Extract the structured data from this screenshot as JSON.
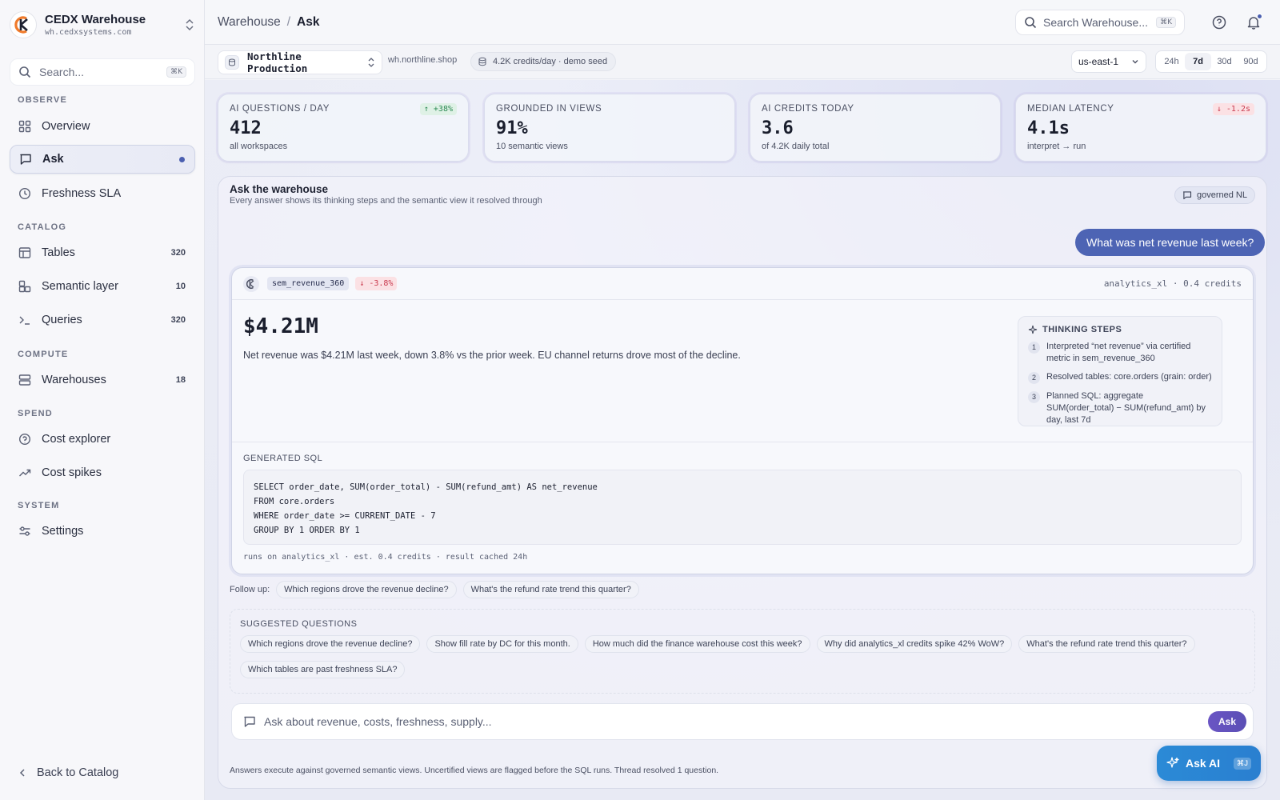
{
  "brand": {
    "name": "CEDX Warehouse",
    "host": "wh.cedxsystems.com"
  },
  "sidebar": {
    "search_placeholder": "Search...",
    "search_shortcut": "⌘K",
    "sections": {
      "observe": "OBSERVE",
      "catalog": "CATALOG",
      "compute": "COMPUTE",
      "spend": "SPEND",
      "system": "SYSTEM"
    },
    "items": {
      "overview": {
        "label": "Overview",
        "icon": "grid-icon"
      },
      "ask": {
        "label": "Ask",
        "icon": "chat-icon",
        "active": true
      },
      "freshness": {
        "label": "Freshness SLA",
        "icon": "clock-icon"
      },
      "tables": {
        "label": "Tables",
        "count": "320",
        "icon": "table-icon"
      },
      "semantic": {
        "label": "Semantic layer",
        "count": "10",
        "icon": "layers-icon"
      },
      "queries": {
        "label": "Queries",
        "count": "320",
        "icon": "terminal-icon"
      },
      "warehouses": {
        "label": "Warehouses",
        "count": "18",
        "icon": "server-icon"
      },
      "cost_explorer": {
        "label": "Cost explorer",
        "icon": "coin-icon"
      },
      "cost_spikes": {
        "label": "Cost spikes",
        "icon": "trend-up-icon"
      },
      "settings": {
        "label": "Settings",
        "icon": "sliders-icon"
      }
    },
    "back_label": "Back to Catalog"
  },
  "header": {
    "breadcrumb_root": "Warehouse",
    "breadcrumb_sep": "/",
    "breadcrumb_current": "Ask",
    "search_placeholder": "Search Warehouse...",
    "search_shortcut": "⌘K"
  },
  "subbar": {
    "environment": "Northline Production",
    "host": "wh.northline.shop",
    "credits": "4.2K credits/day · demo seed",
    "region": "us-east-1",
    "ranges": [
      "24h",
      "7d",
      "30d",
      "90d"
    ],
    "selected_range": "7d"
  },
  "kpis": [
    {
      "label": "AI QUESTIONS / DAY",
      "value": "412",
      "sub": "all workspaces",
      "delta": "↑ +38%",
      "delta_dir": "up"
    },
    {
      "label": "GROUNDED IN VIEWS",
      "value": "91%",
      "sub": "10 semantic views",
      "delta": "",
      "delta_dir": ""
    },
    {
      "label": "AI CREDITS TODAY",
      "value": "3.6",
      "sub": "of 4.2K daily total",
      "delta": "",
      "delta_dir": ""
    },
    {
      "label": "MEDIAN LATENCY",
      "value": "4.1s",
      "sub": "interpret → run",
      "delta": "↓ -1.2s",
      "delta_dir": "down"
    }
  ],
  "ask": {
    "title": "Ask the warehouse",
    "subtitle": "Every answer shows its thinking steps and the semantic view it resolved through",
    "badge": "governed NL",
    "user_question": "What was net revenue last week?",
    "answer": {
      "view": "sem_revenue_360",
      "delta": "↓ -3.8%",
      "meta": "analytics_xl · 0.4 credits",
      "value": "$4.21M",
      "summary": "Net revenue was $4.21M last week, down 3.8% vs the prior week. EU channel returns drove most of the decline.",
      "thinking_title": "THINKING STEPS",
      "steps": [
        {
          "n": "1",
          "text": "Interpreted “net revenue” via certified metric in sem_revenue_360"
        },
        {
          "n": "2",
          "text": "Resolved tables: core.orders (grain: order)"
        },
        {
          "n": "3",
          "text": "Planned SQL: aggregate SUM(order_total) − SUM(refund_amt) by day, last 7d"
        }
      ],
      "sql_label": "GENERATED SQL",
      "sql": "SELECT order_date, SUM(order_total) - SUM(refund_amt) AS net_revenue\nFROM core.orders\nWHERE order_date >= CURRENT_DATE - 7\nGROUP BY 1 ORDER BY 1",
      "sql_footer": "runs on analytics_xl · est. 0.4 credits · result cached 24h"
    },
    "followup_label": "Follow up:",
    "followups": [
      "Which regions drove the revenue decline?",
      "What's the refund rate trend this quarter?"
    ],
    "suggested_label": "SUGGESTED QUESTIONS",
    "suggested": [
      "Which regions drove the revenue decline?",
      "Show fill rate by DC for this month.",
      "How much did the finance warehouse cost this week?",
      "Why did analytics_xl credits spike 42% WoW?",
      "What's the refund rate trend this quarter?",
      "Which tables are past freshness SLA?"
    ],
    "input_placeholder": "Ask about revenue, costs, freshness, supply...",
    "ask_button": "Ask",
    "disclaimer": "Answers execute against governed semantic views. Uncertified views are flagged before the SQL runs. Thread resolved 1 question."
  },
  "fab": {
    "label": "Ask AI",
    "shortcut": "⌘J"
  },
  "colors": {
    "accent": "#4d64b4",
    "fab": "#2a7fd0",
    "up": "#2c8a54",
    "down": "#c93a4e"
  }
}
